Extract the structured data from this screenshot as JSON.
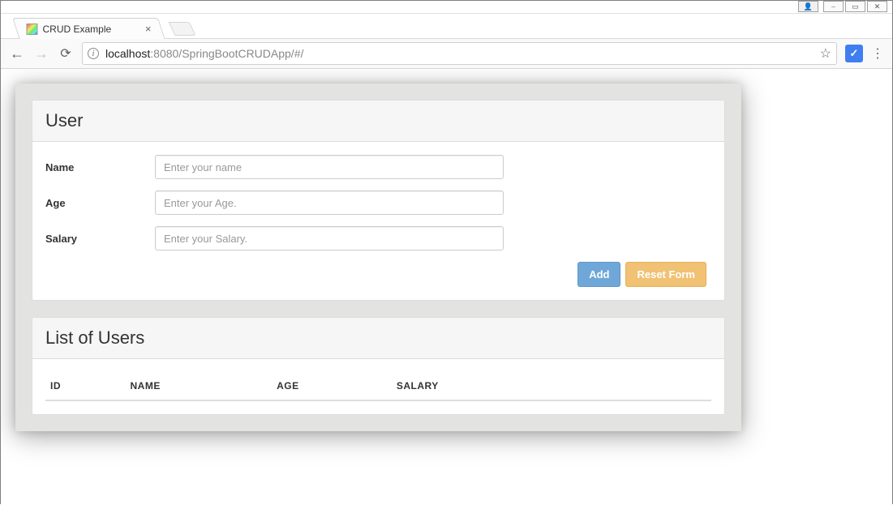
{
  "window": {
    "minimize_glyph": "⎯",
    "maximize_glyph": "▭",
    "close_glyph": "✕",
    "user_glyph": "👤"
  },
  "tab": {
    "title": "CRUD Example",
    "close_glyph": "×"
  },
  "toolbar": {
    "back_glyph": "←",
    "forward_glyph": "→",
    "reload_glyph": "⟳",
    "info_glyph": "i",
    "url_host": "localhost",
    "url_path": ":8080/SpringBootCRUDApp/#/",
    "star_glyph": "☆",
    "ext_glyph": "✓",
    "menu_glyph": "⋮"
  },
  "form_panel": {
    "title": "User",
    "fields": {
      "name_label": "Name",
      "name_placeholder": "Enter your name",
      "age_label": "Age",
      "age_placeholder": "Enter your Age.",
      "salary_label": "Salary",
      "salary_placeholder": "Enter your Salary."
    },
    "actions": {
      "add_label": "Add",
      "reset_label": "Reset Form"
    }
  },
  "list_panel": {
    "title": "List of Users",
    "columns": {
      "id": "ID",
      "name": "NAME",
      "age": "AGE",
      "salary": "SALARY"
    },
    "rows": []
  }
}
